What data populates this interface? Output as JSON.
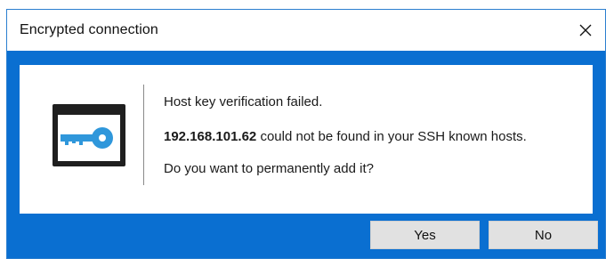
{
  "dialog": {
    "title": "Encrypted connection",
    "close_icon": "close-icon",
    "accent_color": "#0a6fd1",
    "icon": "key-icon",
    "message": {
      "line1": "Host key verification failed.",
      "host": "192.168.101.62",
      "line2_rest": " could not be found in your SSH known hosts.",
      "line3": "Do you want to permanently add it?"
    },
    "buttons": {
      "yes": "Yes",
      "no": "No"
    }
  }
}
